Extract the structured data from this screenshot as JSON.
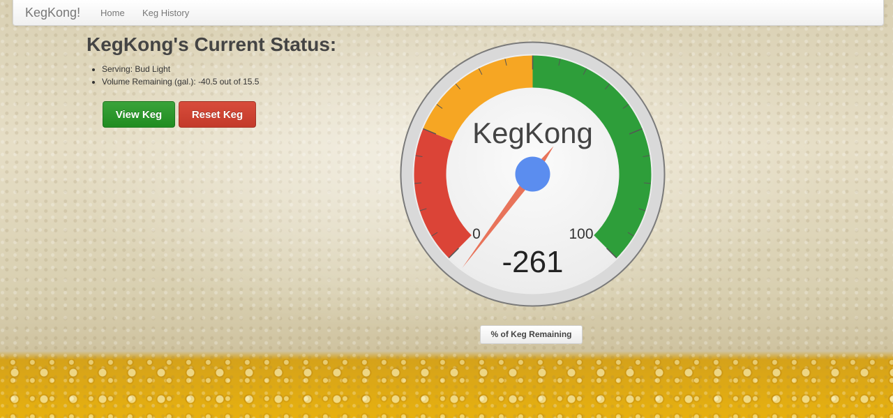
{
  "navbar": {
    "brand": "KegKong!",
    "links": [
      {
        "label": "Home"
      },
      {
        "label": "Keg History"
      }
    ]
  },
  "status": {
    "title": "KegKong's Current Status:",
    "items": [
      "Serving: Bud Light",
      "Volume Remaining (gal.): -40.5 out of 15.5"
    ]
  },
  "buttons": {
    "view": "View Keg",
    "reset": "Reset Keg"
  },
  "gauge": {
    "title": "KegKong",
    "value": "-261",
    "min_label": "0",
    "max_label": "100",
    "min": 0,
    "max": 100,
    "reading": -261,
    "caption": "% of Keg Remaining",
    "colors": {
      "red": "#db4437",
      "orange": "#f6a623",
      "green": "#2e9e3a",
      "needle": "#e8735a",
      "hub": "#5b8def"
    }
  }
}
